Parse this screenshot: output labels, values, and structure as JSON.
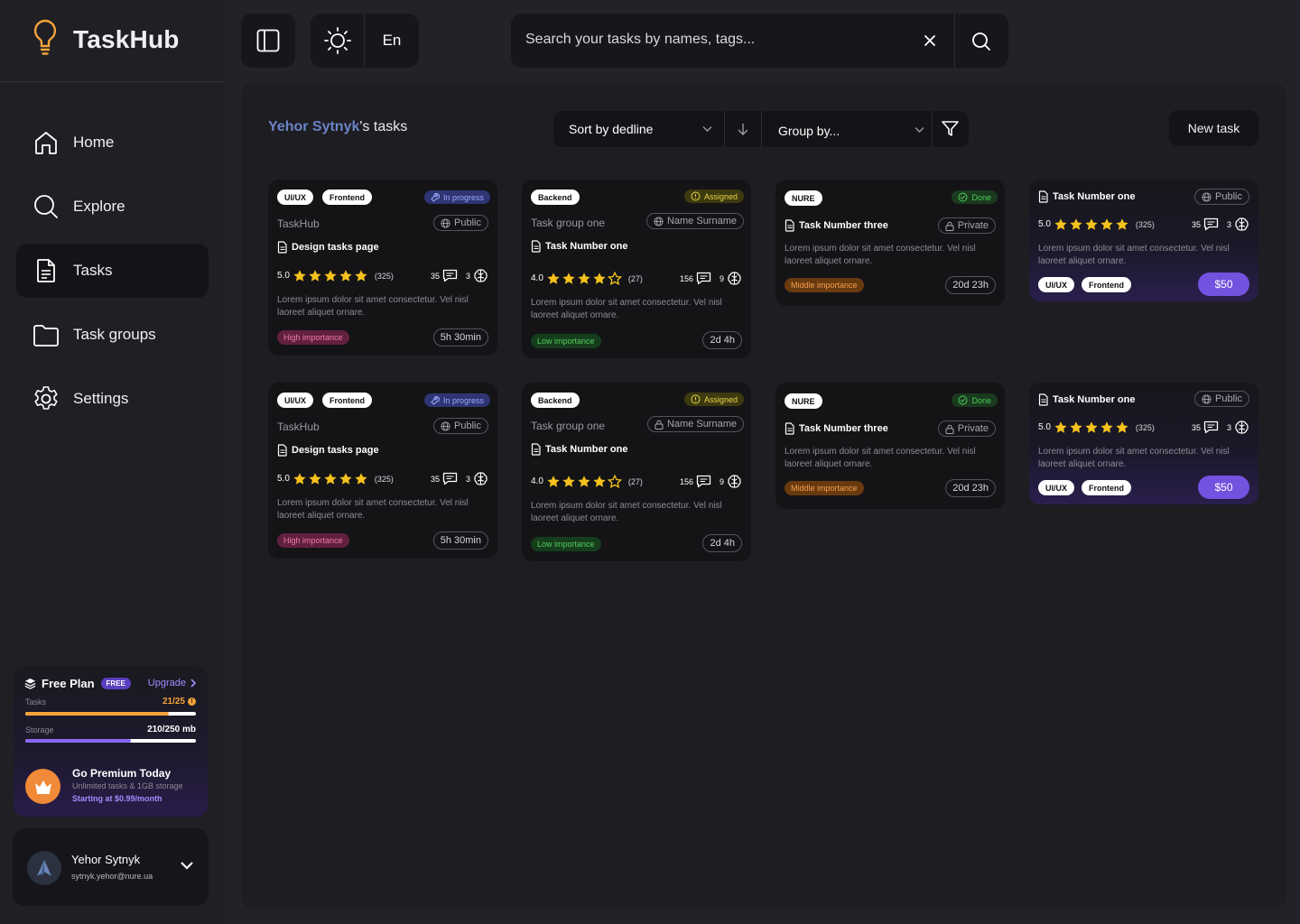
{
  "app": {
    "name": "TaskHub"
  },
  "sidebar": {
    "items": [
      {
        "label": "Home"
      },
      {
        "label": "Explore"
      },
      {
        "label": "Tasks"
      },
      {
        "label": "Task groups"
      },
      {
        "label": "Settings"
      }
    ]
  },
  "plan": {
    "title": "Free Plan",
    "badge": "FREE",
    "upgrade": "Upgrade",
    "tasks_label": "Tasks",
    "tasks_value": "21/25",
    "tasks_progress": 0.84,
    "storage_label": "Storage",
    "storage_value": "210/250 mb",
    "storage_progress": 0.62,
    "premium_title": "Go Premium Today",
    "premium_sub": "Unlimited tasks & 1GB storage",
    "premium_price": "Starting at $0.99/month"
  },
  "user": {
    "name": "Yehor Sytnyk",
    "email": "sytnyk.yehor@nure.ua"
  },
  "topbar": {
    "language": "En",
    "search_placeholder": "Search your tasks by names, tags..."
  },
  "main": {
    "owner": "Yehor Sytnyk",
    "title_suffix": "'s tasks",
    "sort_label": "Sort by dedline",
    "group_label": "Group by...",
    "new_task": "New task"
  },
  "cards": {
    "c1": {
      "tag1": "UI/UX",
      "tag2": "Frontend",
      "status": "In progress",
      "group": "TaskHub",
      "visibility": "Public",
      "name": "Design tasks page",
      "rating": "5.0",
      "reviews": "(325)",
      "comments": "35",
      "brains": "3",
      "desc": "Lorem ipsum dolor sit amet consectetur. Vel nisl laoreet aliquet ornare.",
      "importance": "High importance",
      "time": "5h 30min"
    },
    "c2": {
      "tag1": "Backend",
      "status": "Assigned",
      "group": "Task group one",
      "assignee": "Name Surname",
      "name": "Task Number one",
      "rating": "4.0",
      "reviews": "(27)",
      "comments": "156",
      "brains": "9",
      "desc": "Lorem ipsum dolor sit amet consectetur. Vel nisl laoreet aliquet ornare.",
      "importance": "Low importance",
      "time": "2d 4h"
    },
    "c3": {
      "tag1": "NURE",
      "status": "Done",
      "name": "Task Number three",
      "visibility": "Private",
      "desc": "Lorem ipsum dolor sit amet consectetur. Vel nisl laoreet aliquet ornare.",
      "importance": "Middle importance",
      "time": "20d 23h"
    },
    "c4": {
      "name": "Task Number one",
      "visibility": "Public",
      "rating": "5.0",
      "reviews": "(325)",
      "comments": "35",
      "brains": "3",
      "desc": "Lorem ipsum dolor sit amet consectetur. Vel nisl laoreet aliquet ornare.",
      "tag1": "UI/UX",
      "tag2": "Frontend",
      "price": "$50"
    }
  }
}
